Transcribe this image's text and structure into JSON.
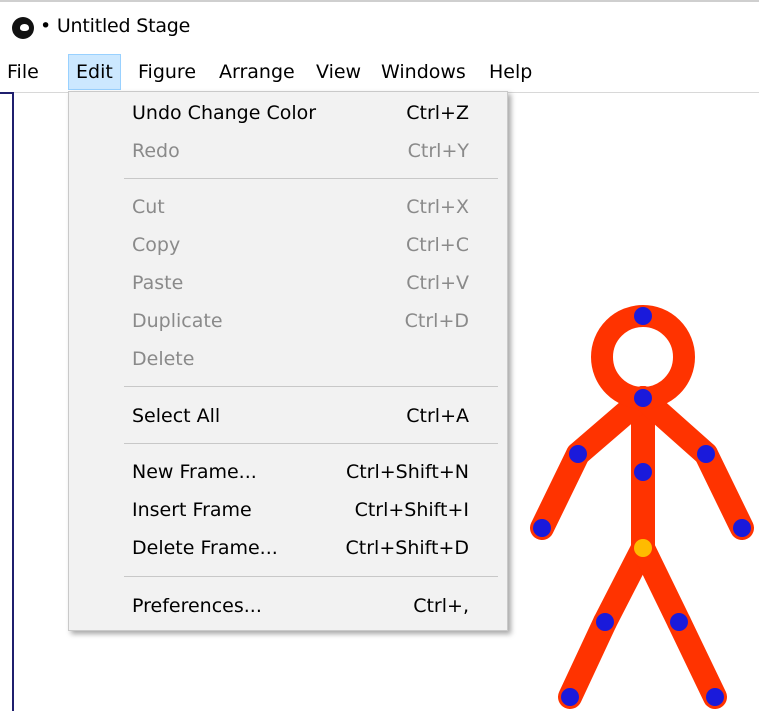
{
  "window": {
    "title": "• Untitled Stage"
  },
  "menubar": {
    "items": [
      {
        "label": "File"
      },
      {
        "label": "Edit"
      },
      {
        "label": "Figure"
      },
      {
        "label": "Arrange"
      },
      {
        "label": "View"
      },
      {
        "label": "Windows"
      },
      {
        "label": "Help"
      }
    ],
    "active_index": 1
  },
  "edit_menu": {
    "items": [
      {
        "label": "Undo Change Color",
        "shortcut": "Ctrl+Z",
        "enabled": true
      },
      {
        "label": "Redo",
        "shortcut": "Ctrl+Y",
        "enabled": false
      },
      {
        "label": "Cut",
        "shortcut": "Ctrl+X",
        "enabled": false
      },
      {
        "label": "Copy",
        "shortcut": "Ctrl+C",
        "enabled": false
      },
      {
        "label": "Paste",
        "shortcut": "Ctrl+V",
        "enabled": false
      },
      {
        "label": "Duplicate",
        "shortcut": "Ctrl+D",
        "enabled": false
      },
      {
        "label": "Delete",
        "shortcut": "",
        "enabled": false
      },
      {
        "label": "Select All",
        "shortcut": "Ctrl+A",
        "enabled": true
      },
      {
        "label": "New Frame...",
        "shortcut": "Ctrl+Shift+N",
        "enabled": true
      },
      {
        "label": "Insert Frame",
        "shortcut": "Ctrl+Shift+I",
        "enabled": true
      },
      {
        "label": "Delete Frame...",
        "shortcut": "Ctrl+Shift+D",
        "enabled": true
      },
      {
        "label": "Preferences...",
        "shortcut": "Ctrl+,",
        "enabled": true
      }
    ]
  },
  "stage": {
    "figure": {
      "body_color": "#ff3300",
      "joint_color": "#1a1adb",
      "origin_joint_color": "#ffbb00"
    }
  },
  "colors": {
    "menu_active_bg": "#cce8ff",
    "menu_active_border": "#99d1ff",
    "dropdown_bg": "#f2f2f2",
    "disabled_text": "#8a8a8a"
  }
}
